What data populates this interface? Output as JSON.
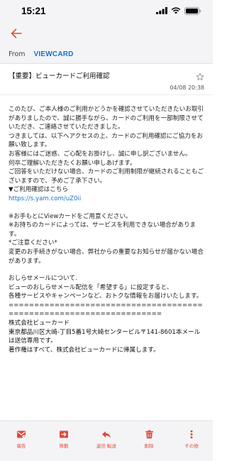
{
  "status_bar": {
    "time": "15:21"
  },
  "header": {
    "from_label": "From",
    "from_value": "VIEWCARD"
  },
  "message": {
    "subject": "【重要】ビューカードご利用確認",
    "date": "04/08 20:38",
    "body": {
      "intro": "このたび、ご本人様のご利用かどうかを確認させていただきたいお取引がありましたので、誠に勝手ながら、カードのご利用を一部制限させていただき、ご連絡させていただきました。\nつきましては、以下へアクセスの上、カードのご利用確認にご協力をお願い致します。\nお客様にはご迷惑、ご心配をお掛けし、誠に申し訳ございません。\n何卒ご理解いただきたくお願い申しあげます。\nご回答をいただけない場合、カードのご利用制限が継続されることもございますので、予めご了承下さい。\n▼ご利用確認はこちら",
      "link": "https://s.yam.com/uZ0ii",
      "notice": "※お手もとにViewカードをご用意ください。\n※お持ちのカードによっては、サービスを利用できない場合があります。\n*ご注意ください*\n変更のお手続きがない場合、弊社からの重要なお知らせが届かない場合があります。",
      "newsletter": "おしらせメールについて.\nビューのおしらせメール配信を「希望する」に設定すると、\n各種サービスやキャンペーンなど、おトクな情報をお届けいたします。",
      "separator": "====================================================================",
      "signature": "株式会社ビューカード\n東京都品川区大崎-丁目5番1号大崎センタービル〒141-8601本メールは送信専用です。\n著作権はすべて、株式会社ビューカードに帰属します。"
    }
  },
  "toolbar": {
    "items": [
      {
        "label": "報告",
        "icon": "report-icon"
      },
      {
        "label": "移動",
        "icon": "move-icon"
      },
      {
        "label": "返信·転送",
        "icon": "reply-icon"
      },
      {
        "label": "削除",
        "icon": "trash-icon"
      },
      {
        "label": "その他",
        "icon": "more-icon"
      }
    ]
  },
  "colors": {
    "accent": "#e04a3a",
    "link": "#1a73c8",
    "bar_bg": "#f4f4f6"
  }
}
